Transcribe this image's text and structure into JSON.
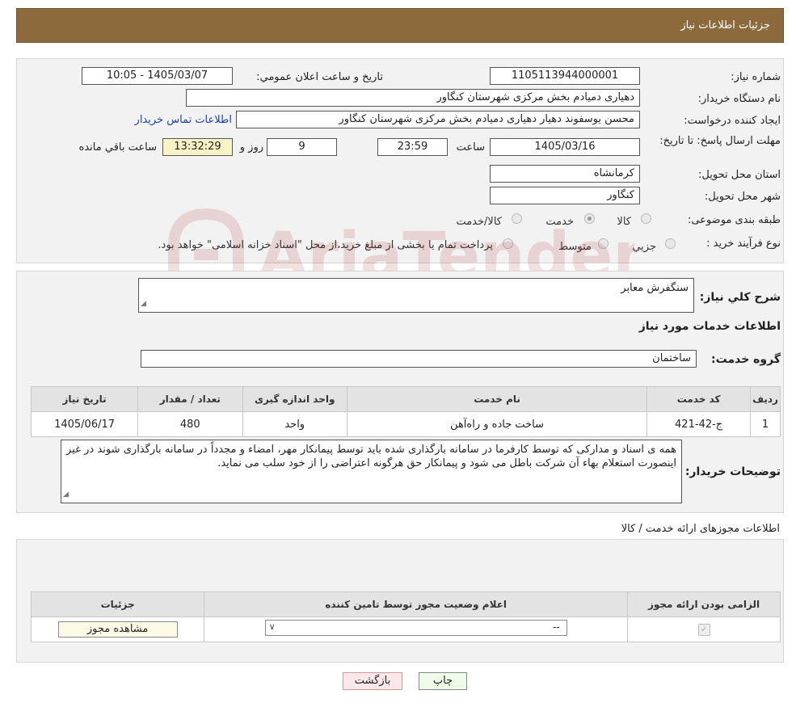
{
  "header": {
    "title": "جزئیات اطلاعات نیاز"
  },
  "need_number": {
    "label": "شماره نیاز:",
    "value": "1105113944000001"
  },
  "announce_date": {
    "label": "تاریخ و ساعت اعلان عمومي:",
    "value": "1405/03/07 - 10:05"
  },
  "buyer_org": {
    "label": "نام دستگاه خريدار:",
    "value": "دهیاری دمیادم بخش مرکزی شهرستان کنگاور"
  },
  "requester": {
    "label": "ایجاد کننده درخواست:",
    "value": "محسن یوسفوند دهیار دهیاری دمیادم بخش مرکزی شهرستان کنگاور",
    "contact_link": "اطلاعات تماس خریدار"
  },
  "deadline": {
    "label": "مهلت ارسال پاسخ: تا تاریخ:",
    "date": "1405/03/16",
    "time_label": "ساعت",
    "time": "23:59",
    "days": "9",
    "days_label": "روز و",
    "remaining": "13:32:29",
    "remaining_label": "ساعت باقي مانده"
  },
  "province": {
    "label": "استان محل تحویل:",
    "value": "کرمانشاه"
  },
  "city": {
    "label": "شهر محل تحویل:",
    "value": "کنگاور"
  },
  "category": {
    "label": "طبقه بندی موضوعی:",
    "options": [
      "کالا",
      "خدمت",
      "کالا/خدمت"
    ],
    "selected": "خدمت"
  },
  "process": {
    "label": "نوع فرآیند خرید :",
    "options": [
      "جزیي",
      "متوسط"
    ],
    "note": "پرداخت تمام یا بخشی از مبلغ خرید،از محل \"اسناد خزانه اسلامی\" خواهد بود."
  },
  "summary": {
    "label": "شرح کلي نياز:",
    "value": "سنگفرش معابر"
  },
  "services_heading": "اطلاعات خدمات مورد نياز",
  "service_group": {
    "label": "گروه خدمت:",
    "value": "ساختمان"
  },
  "services_table": {
    "headers": [
      "رديف",
      "کد خدمت",
      "نام خدمت",
      "واحد اندازه گيری",
      "تعداد / مقدار",
      "تاريخ نياز"
    ],
    "rows": [
      [
        "1",
        "ج-42-421",
        "ساخت جاده و راه‌آهن",
        "واحد",
        "480",
        "1405/06/17"
      ]
    ]
  },
  "buyer_notes": {
    "label": "توضيحات خريدار:",
    "value": "همه ی اسناد و مدارکی که توسط کارفرما در سامانه بارگذاری شده باید توسط پیمانکار مهر،  امضاء و  مجدداً در سامانه بارگذاری شوند در غیر اینصورت استعلام بهاء آن شرکت باطل می شود و  پیمانکار حق هرگونه اعتراضی را از خود سلب می نماید."
  },
  "permits_heading": "اطلاعات مجوزهای ارائه خدمت / کالا",
  "permits_table": {
    "headers": [
      "الزامی بودن ارائه مجوز",
      "اعلام وضعیت مجوز توسط تامین کننده",
      "جزئیات"
    ],
    "status_value": "--",
    "view_button": "مشاهده مجوز"
  },
  "buttons": {
    "print": "چاپ",
    "back": "بازگشت"
  },
  "watermark": "AriaTender.net",
  "colors": {
    "header_bg": "#8c6a3c",
    "back_button_bg": "#fce8e8",
    "print_button_bg": "#eefbe8",
    "link": "#1a3fb0"
  }
}
